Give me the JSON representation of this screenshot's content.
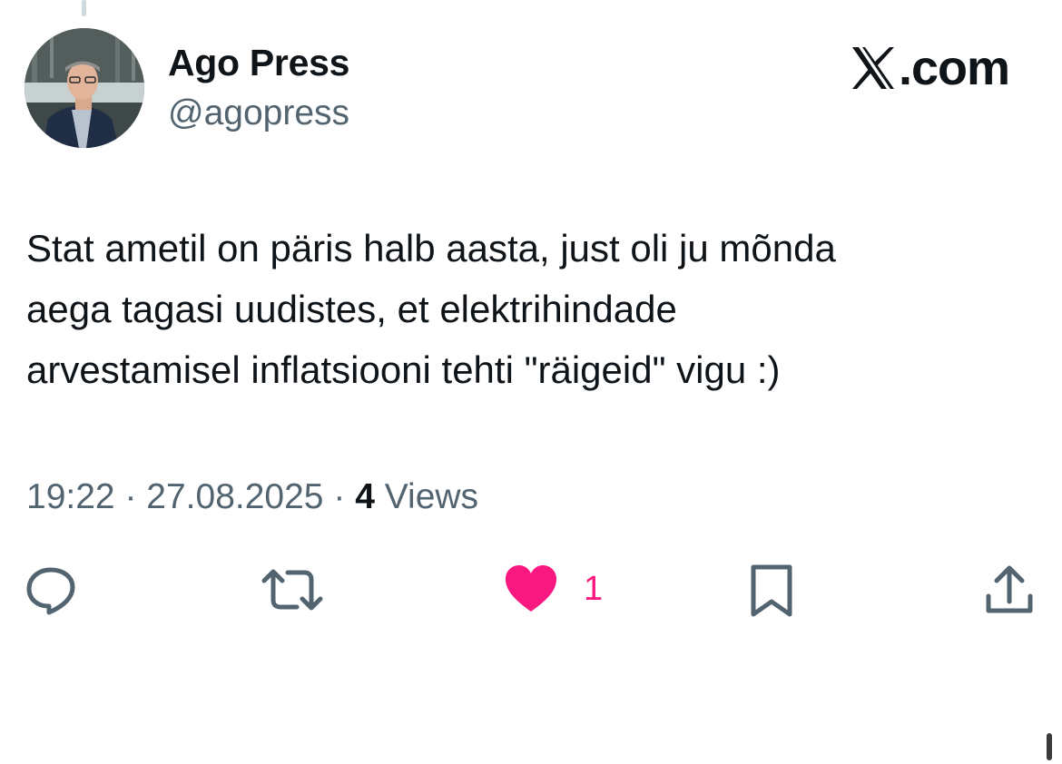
{
  "author": {
    "display_name": "Ago Press",
    "handle": "@agopress"
  },
  "brand": {
    "label": ".com",
    "icon": "x-logo-icon"
  },
  "tweet": {
    "lines": [
      "Stat ametil on päris halb aasta, just oli ju mõnda",
      "aega tagasi uudistes, et elektrihindade",
      "arvestamisel inflatsiooni tehti \"räigeid\" vigu :)"
    ]
  },
  "meta": {
    "time": "19:22",
    "separator": "·",
    "date": "27.08.2025",
    "views_count": "4",
    "views_label": "Views"
  },
  "actions": {
    "reply_icon": "speech-bubble-icon",
    "retweet_icon": "retweet-icon",
    "like_icon": "heart-icon",
    "like_count": "1",
    "like_color": "#f91880",
    "bookmark_icon": "bookmark-icon",
    "share_icon": "share-icon",
    "icon_color": "#536471"
  }
}
